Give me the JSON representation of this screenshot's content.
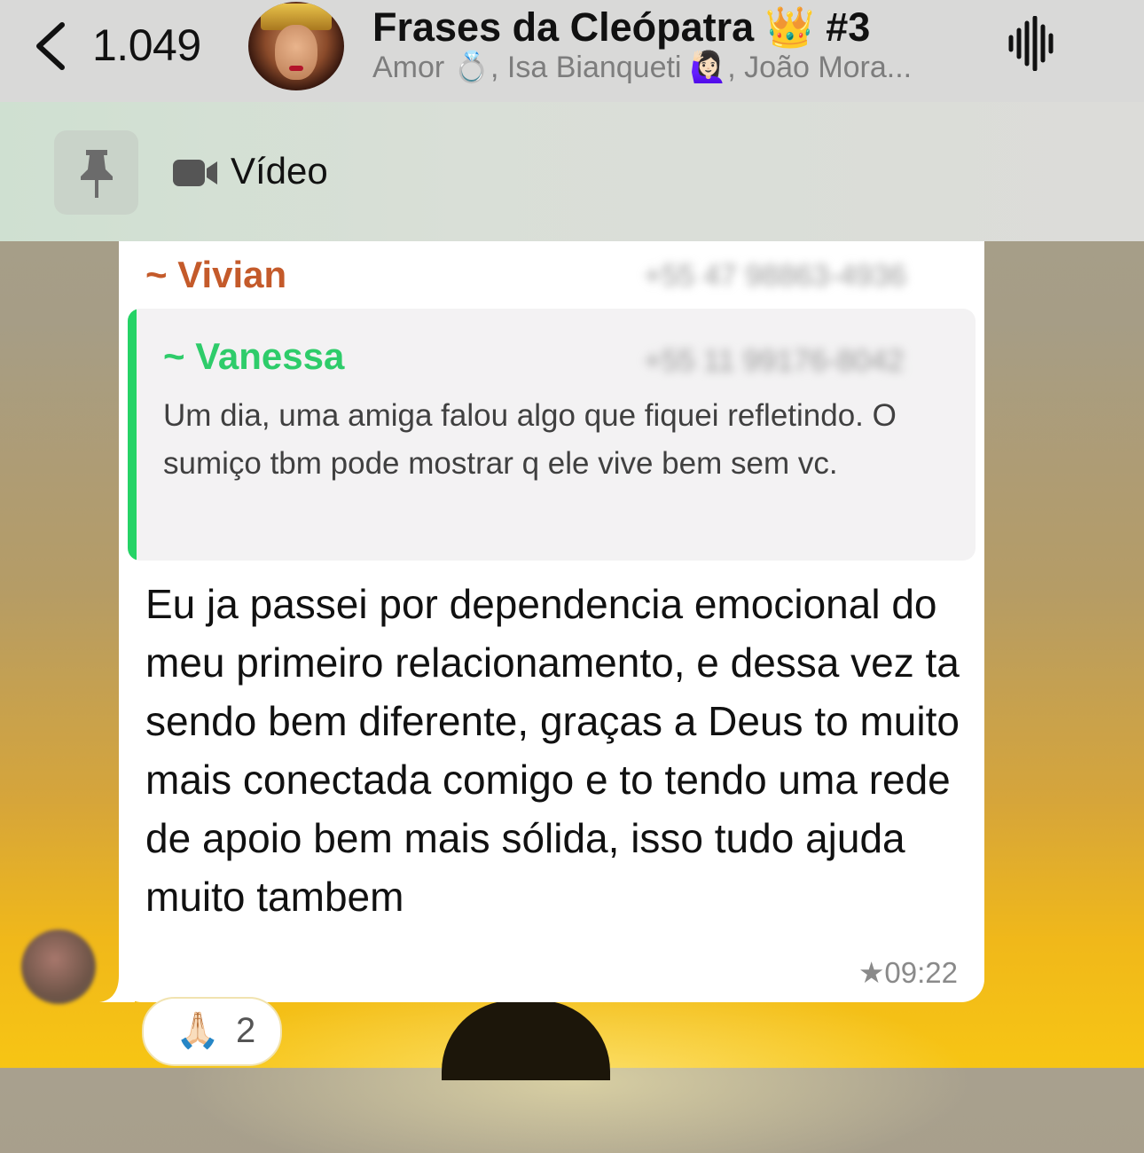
{
  "header": {
    "back_count": "1.049",
    "title": "Frases da Cleópatra 👑 #3",
    "subtitle": "Amor 💍, Isa Bianqueti 🙋🏻‍♀️, João Mora..."
  },
  "pinned": {
    "label": "Vídeo"
  },
  "message": {
    "sender": "~ Vivian",
    "sender_phone": "+55 47 98863-4936",
    "quote": {
      "sender": "~ Vanessa",
      "sender_phone": "+55 11 99176-8042",
      "text": "Um dia, uma amiga falou algo que fiquei refletindo. O sumiço tbm pode mostrar q ele vive bem sem vc."
    },
    "text": "Eu ja passei por dependencia emocional do meu primeiro relacionamento, e dessa vez ta sendo bem diferente, graças a Deus to muito mais conectada comigo e to tendo uma rede de apoio bem mais sólida, isso tudo ajuda muito tambem",
    "star": "★",
    "time": "09:22",
    "reaction": {
      "emoji": "🙏🏻",
      "count": "2"
    }
  },
  "colors": {
    "sender": "#c45a2a",
    "quote_sender": "#2ecc6a",
    "quote_bar": "#25d366"
  }
}
